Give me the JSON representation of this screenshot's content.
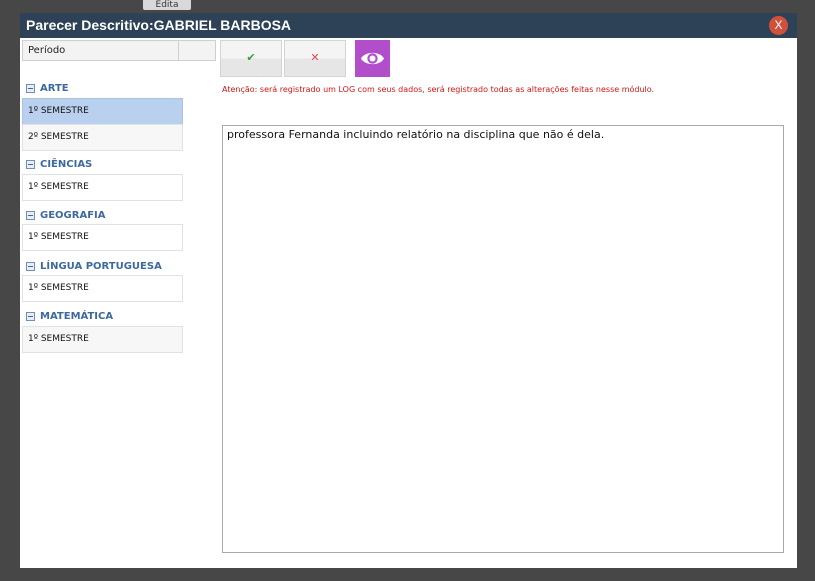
{
  "background": {
    "tab_label": "Edita"
  },
  "dialog": {
    "title": "Parecer Descritivo:GABRIEL BARBOSA",
    "close_label": "X"
  },
  "left_panel": {
    "column_header": "Período",
    "groups": [
      {
        "name": "ARTE",
        "items": [
          "1º SEMESTRE",
          "2º SEMESTRE"
        ]
      },
      {
        "name": "CIÊNCIAS",
        "items": [
          "1º SEMESTRE"
        ]
      },
      {
        "name": "GEOGRAFIA",
        "items": [
          "1º SEMESTRE"
        ]
      },
      {
        "name": "LÍNGUA PORTUGUESA",
        "items": [
          "1º SEMESTRE"
        ]
      },
      {
        "name": "MATEMÁTICA",
        "items": [
          "1º SEMESTRE"
        ]
      }
    ],
    "selected": "ARTE / 1º SEMESTRE"
  },
  "toolbar": {
    "ok_icon": "checkmark-icon",
    "ok_glyph": "✔",
    "cancel_icon": "x-icon",
    "cancel_glyph": "✕",
    "view_icon": "eye-icon"
  },
  "warning_text": "Atenção: será registrado um LOG com seus dados, será registrado todas as alterações feitas nesse módulo.",
  "editor": {
    "content": "professora Fernanda incluindo relatório na disciplina que não é dela."
  },
  "colors": {
    "titlebar": "#2d4256",
    "close": "#d1503b",
    "view_button": "#b24ec9",
    "warning": "#d01616",
    "selected_row": "#b9d1ee",
    "group_text": "#3d6a9e"
  }
}
